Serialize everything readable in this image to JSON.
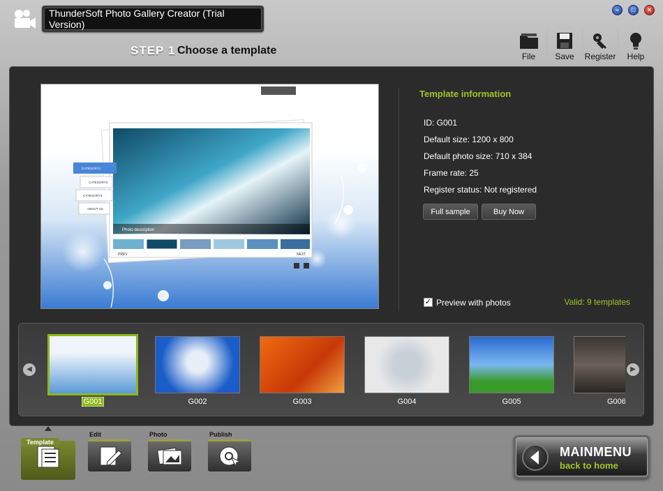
{
  "window": {
    "title": "ThunderSoft Photo Gallery Creator (Trial Version)",
    "buttons": [
      "minimize",
      "maximize",
      "close"
    ]
  },
  "step": {
    "number": "STEP 1",
    "text": "Choose a template"
  },
  "toolbar": {
    "file": "File",
    "save": "Save",
    "register": "Register",
    "help": "Help"
  },
  "preview": {
    "caption": "Photo description",
    "prev": "PREV",
    "next": "NEXT",
    "menu": [
      "CATEGORY1",
      "CATEGORY2",
      "CATEGORY3",
      "ABOUT US"
    ]
  },
  "info": {
    "title": "Template information",
    "id": "ID: G001",
    "default_size": "Default size: 1200 x 800",
    "photo_size": "Default photo size: 710 x 384",
    "frame_rate": "Frame rate: 25",
    "register_status": "Register status: Not registered",
    "full_sample": "Full sample",
    "buy_now": "Buy Now",
    "preview_with_photos": "Preview with photos",
    "preview_checked": true,
    "valid": "Valid: 9 templates"
  },
  "templates": [
    {
      "id": "G001",
      "selected": true
    },
    {
      "id": "G002",
      "selected": false
    },
    {
      "id": "G003",
      "selected": false
    },
    {
      "id": "G004",
      "selected": false
    },
    {
      "id": "G005",
      "selected": false
    },
    {
      "id": "G006",
      "selected": false
    }
  ],
  "tabs": {
    "template": "Template",
    "edit": "Edit",
    "photo": "Photo",
    "publish": "Publish"
  },
  "main_menu": {
    "title": "MAINMENU",
    "subtitle": "back to home"
  },
  "colors": {
    "accent": "#9fc62a",
    "panel": "#2b2b2b",
    "selected_border": "#8db81a"
  }
}
